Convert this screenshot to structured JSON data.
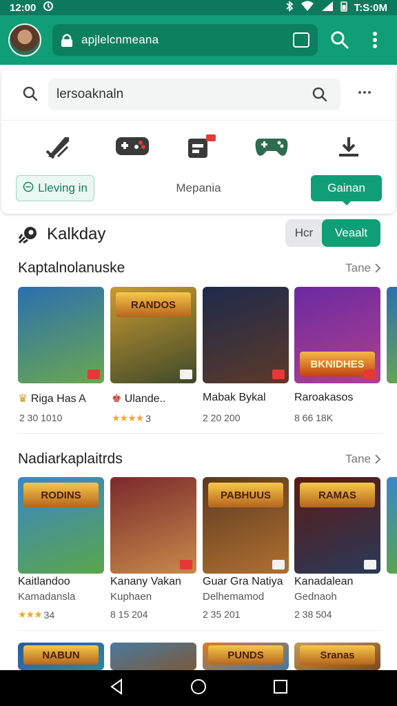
{
  "status_bar": {
    "time": "12:00",
    "right_time": "T:S:0M"
  },
  "app_bar": {
    "url": "apjlelcnmeana"
  },
  "search": {
    "query": "lersoaknaln"
  },
  "chips": {
    "left": "Lleving in",
    "middle": "Mepania",
    "right": "Gainan"
  },
  "section": {
    "title": "Kalkday",
    "toggle_a": "Hcr",
    "toggle_b": "Veaalt"
  },
  "rows": [
    {
      "title": "Kaptalnolanuske",
      "more": "Tane",
      "items": [
        {
          "label": "Riga Has A",
          "meta": "2 30 1010",
          "colors": [
            "#2b6fb0",
            "#6aa84f"
          ]
        },
        {
          "label": "Ulande..",
          "meta": "3",
          "stars": "★★★★",
          "banner": "RANDOS",
          "colors": [
            "#c99a32",
            "#3e4a2a"
          ]
        },
        {
          "label": "Mabak Bykal",
          "meta": "2 20 200",
          "colors": [
            "#1e2a4a",
            "#5b3a2a"
          ]
        },
        {
          "label": "Raroakasos",
          "meta": "8 66 18K",
          "banner": "BKNIDHES",
          "colors": [
            "#6a2aa0",
            "#b04090"
          ]
        }
      ]
    },
    {
      "title": "Nadiarkaplaitrds",
      "more": "Tane",
      "items": [
        {
          "label": "Kaitlandoo",
          "sub": "Kamadansla",
          "meta": "34",
          "stars": "★★★",
          "banner": "RODINS",
          "colors": [
            "#3a86c8",
            "#5aa64a"
          ]
        },
        {
          "label": "Kanany Vakan",
          "sub": "Kuphaen",
          "meta": "8 15 204",
          "colors": [
            "#7a2a2a",
            "#c88a4a"
          ]
        },
        {
          "label": "Guar Gra Natiya",
          "sub": "Delhemamod",
          "meta": "2 35 201",
          "banner": "PABHUUS",
          "colors": [
            "#5a3a20",
            "#b07030"
          ]
        },
        {
          "label": "Kanadalean",
          "sub": "Gednaoh",
          "meta": "2 38 504",
          "banner": "RAMAS",
          "colors": [
            "#5a1a14",
            "#2a3a5a"
          ]
        }
      ]
    },
    {
      "title": "",
      "more": "",
      "items": [
        {
          "label": "",
          "banner": "NABUN",
          "colors": [
            "#2a5aa0",
            "#2a8aa0"
          ]
        },
        {
          "label": "",
          "colors": [
            "#4a7aa0",
            "#7a5a3a"
          ]
        },
        {
          "label": "",
          "banner": "PUNDS",
          "colors": [
            "#e07a20",
            "#3a7ab0"
          ]
        },
        {
          "label": "",
          "banner": "Sranas",
          "colors": [
            "#c89a52",
            "#7a4a20"
          ]
        }
      ]
    }
  ],
  "colors": {
    "accent": "#0f9e75",
    "accent_dark": "#0b7f5e",
    "star": "#f5a623"
  }
}
